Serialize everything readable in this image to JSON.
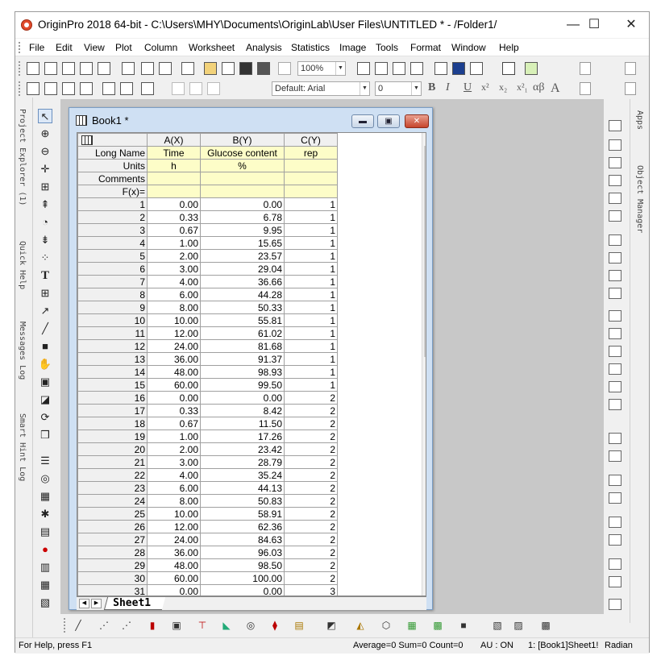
{
  "window": {
    "title": "OriginPro 2018 64-bit - C:\\Users\\MHY\\Documents\\OriginLab\\User Files\\UNTITLED * - /Folder1/"
  },
  "menu": [
    "File",
    "Edit",
    "View",
    "Plot",
    "Column",
    "Worksheet",
    "Analysis",
    "Statistics",
    "Image",
    "Tools",
    "Format",
    "Window",
    "Help"
  ],
  "toolbar": {
    "zoom": "100%",
    "font": "Default: Arial",
    "font_size": "0",
    "bold": "B",
    "italic": "I",
    "underline": "U",
    "greek": "αβ",
    "font_a": "A"
  },
  "left_panels": [
    "Project Explorer (1)",
    "Quick Help",
    "Messages Log",
    "Smart Hint Log"
  ],
  "right_panels": [
    "Apps",
    "Object Manager"
  ],
  "book": {
    "title": "Book1 *",
    "columns": [
      "A(X)",
      "B(Y)",
      "C(Y)"
    ],
    "meta_labels": [
      "Long Name",
      "Units",
      "Comments",
      "F(x)="
    ],
    "long_names": [
      "Time",
      "Glucose content",
      "rep"
    ],
    "units": [
      "h",
      "%",
      ""
    ],
    "rows": [
      [
        "1",
        "0.00",
        "0.00",
        "1"
      ],
      [
        "2",
        "0.33",
        "6.78",
        "1"
      ],
      [
        "3",
        "0.67",
        "9.95",
        "1"
      ],
      [
        "4",
        "1.00",
        "15.65",
        "1"
      ],
      [
        "5",
        "2.00",
        "23.57",
        "1"
      ],
      [
        "6",
        "3.00",
        "29.04",
        "1"
      ],
      [
        "7",
        "4.00",
        "36.66",
        "1"
      ],
      [
        "8",
        "6.00",
        "44.28",
        "1"
      ],
      [
        "9",
        "8.00",
        "50.33",
        "1"
      ],
      [
        "10",
        "10.00",
        "55.81",
        "1"
      ],
      [
        "11",
        "12.00",
        "61.02",
        "1"
      ],
      [
        "12",
        "24.00",
        "81.68",
        "1"
      ],
      [
        "13",
        "36.00",
        "91.37",
        "1"
      ],
      [
        "14",
        "48.00",
        "98.93",
        "1"
      ],
      [
        "15",
        "60.00",
        "99.50",
        "1"
      ],
      [
        "16",
        "0.00",
        "0.00",
        "2"
      ],
      [
        "17",
        "0.33",
        "8.42",
        "2"
      ],
      [
        "18",
        "0.67",
        "11.50",
        "2"
      ],
      [
        "19",
        "1.00",
        "17.26",
        "2"
      ],
      [
        "20",
        "2.00",
        "23.42",
        "2"
      ],
      [
        "21",
        "3.00",
        "28.79",
        "2"
      ],
      [
        "22",
        "4.00",
        "35.24",
        "2"
      ],
      [
        "23",
        "6.00",
        "44.13",
        "2"
      ],
      [
        "24",
        "8.00",
        "50.83",
        "2"
      ],
      [
        "25",
        "10.00",
        "58.91",
        "2"
      ],
      [
        "26",
        "12.00",
        "62.36",
        "2"
      ],
      [
        "27",
        "24.00",
        "84.63",
        "2"
      ],
      [
        "28",
        "36.00",
        "96.03",
        "2"
      ],
      [
        "29",
        "48.00",
        "98.50",
        "2"
      ],
      [
        "30",
        "60.00",
        "100.00",
        "2"
      ],
      [
        "31",
        "0.00",
        "0.00",
        "3"
      ]
    ],
    "sheet_tab": "Sheet1"
  },
  "status": {
    "help": "For Help, press F1",
    "stats": "Average=0 Sum=0 Count=0",
    "au": "AU : ON",
    "ref": "1: [Book1]Sheet1!",
    "angle": "Radian"
  }
}
